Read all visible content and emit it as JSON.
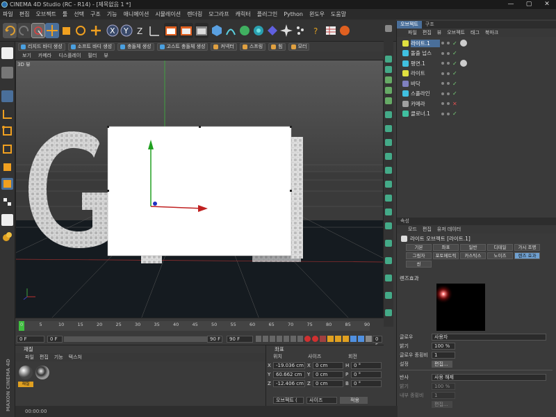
{
  "titlebar": {
    "title": "CINEMA 4D Studio (RC - R14) - [제목없음 1 *]",
    "min": "—",
    "max": "▢",
    "close": "✕"
  },
  "menubar": [
    "파일",
    "편집",
    "오브젝트",
    "툴",
    "선택",
    "구조",
    "기능",
    "애니메이션",
    "시뮬레이션",
    "렌더링",
    "모그라프",
    "캐릭터",
    "플러그인",
    "Python",
    "윈도우",
    "도움말"
  ],
  "subbar": [
    {
      "label": "리지드 바디 생성",
      "color": "#4aa0e0"
    },
    {
      "label": "소프트 바디 생성",
      "color": "#4aa0e0"
    },
    {
      "label": "충돌체 생성",
      "color": "#4aa0e0"
    },
    {
      "label": "고스트 충돌체 생성",
      "color": "#4aa0e0"
    },
    {
      "label": "커넥터",
      "color": "#e0a040"
    },
    {
      "label": "스프링",
      "color": "#e0a040"
    },
    {
      "label": "힘",
      "color": "#e0a040"
    },
    {
      "label": "모터",
      "color": "#e0a040"
    }
  ],
  "viewport_menu": [
    "보기",
    "카메라",
    "디스플레이",
    "필터",
    "뷰"
  ],
  "viewport": {
    "label": "3D 뷰",
    "text_3d": "G"
  },
  "object_panel": {
    "tabs": [
      "오브젝트",
      "구조"
    ],
    "menu": [
      "파일",
      "편집",
      "뷰",
      "오브젝트",
      "태그",
      "북마크"
    ],
    "objects": [
      {
        "name": "라이트.1",
        "color": "#e0e040",
        "selected": true,
        "status": "check"
      },
      {
        "name": "돌출 넙스",
        "color": "#40c0e0",
        "selected": false,
        "status": "check"
      },
      {
        "name": "평면.1",
        "color": "#40c0e0",
        "selected": false,
        "status": "check"
      },
      {
        "name": "라이트",
        "color": "#e0e040",
        "selected": false,
        "status": "check"
      },
      {
        "name": "바닥",
        "color": "#8080c0",
        "selected": false,
        "status": "check"
      },
      {
        "name": "스플라인",
        "color": "#40c0e0",
        "selected": false,
        "status": "check"
      },
      {
        "name": "카메라",
        "color": "#a0a0a0",
        "selected": false,
        "status": "cross"
      },
      {
        "name": "클로너.1",
        "color": "#40c0a0",
        "selected": false,
        "status": "check"
      }
    ]
  },
  "attr_panel": {
    "tab": "속성",
    "menu": [
      "모드",
      "편집",
      "유저 데이터"
    ],
    "title": "라이트 오브젝트 [라이트.1]",
    "tabs": [
      "기본",
      "좌표",
      "일반",
      "디테일",
      "가시 조명",
      "그림자",
      "포토메트릭",
      "카스틱스",
      "노이즈",
      "렌즈 효과",
      "씬"
    ],
    "active_tab": "렌즈 효과",
    "section": "렌즈효과",
    "glow_label": "글로우",
    "glow_value": "사용자",
    "brightness_label": "밝기",
    "brightness_value": "100 %",
    "glow_aspect_label": "글로우 종횡비",
    "glow_aspect_value": "1",
    "settings_label": "설정",
    "settings_button": "편집...",
    "reflex_label": "반사",
    "reflex_value": "사용 해제",
    "reflex_brightness_label": "밝기",
    "reflex_brightness_value": "100 %",
    "reflex_aspect_label": "내부 종횡비",
    "reflex_aspect_value": "1",
    "reflex_edit": "편집..."
  },
  "timeline": {
    "ticks": [
      "0",
      "5",
      "10",
      "15",
      "20",
      "25",
      "30",
      "35",
      "40",
      "45",
      "50",
      "55",
      "60",
      "65",
      "70",
      "75",
      "80",
      "85",
      "90"
    ],
    "start": "0 F",
    "current": "0 F",
    "end1": "90 F",
    "end2": "90 F",
    "right": "0 F"
  },
  "material_panel": {
    "title": "재질",
    "menu": [
      "파일",
      "편집",
      "기능",
      "텍스처"
    ],
    "items": [
      "재질",
      ""
    ]
  },
  "coord_panel": {
    "title": "좌표",
    "headers": [
      "위치",
      "사이즈",
      "회전"
    ],
    "rows": [
      {
        "axis": "X",
        "pos": "-19.036 cm",
        "sizeaxis": "X",
        "size": "0 cm",
        "rotaxis": "H",
        "rot": "0 °"
      },
      {
        "axis": "Y",
        "pos": "60.662 cm",
        "sizeaxis": "Y",
        "size": "0 cm",
        "rotaxis": "P",
        "rot": "0 °"
      },
      {
        "axis": "Z",
        "pos": "-12.406 cm",
        "sizeaxis": "Z",
        "size": "0 cm",
        "rotaxis": "B",
        "rot": "0 °"
      }
    ],
    "mode": "오브젝트 (",
    "size_mode": "사이즈",
    "apply": "적용"
  },
  "statusbar": {
    "time": "00:00:00"
  },
  "brand": "MAXON CINEMA 4D"
}
